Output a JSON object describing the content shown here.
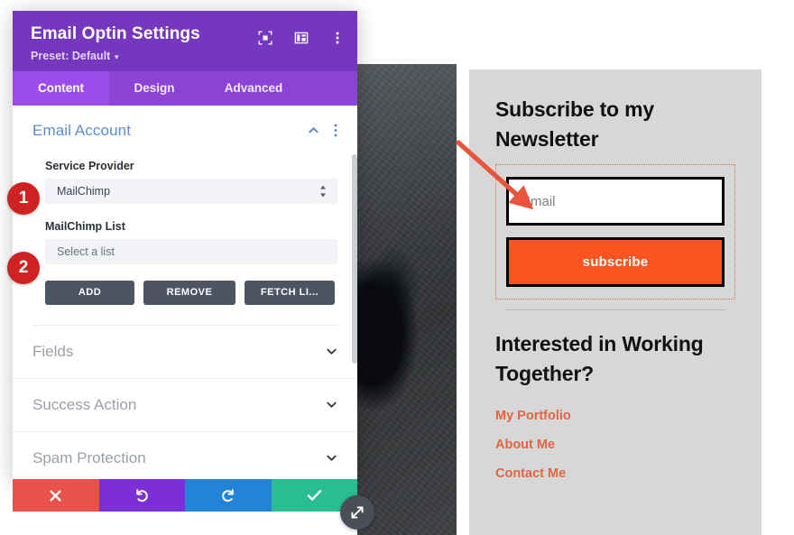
{
  "modal": {
    "title": "Email Optin Settings",
    "preset_label": "Preset: Default",
    "header_icons": [
      {
        "name": "focus-icon"
      },
      {
        "name": "layout-columns-icon"
      },
      {
        "name": "more-vertical-icon"
      }
    ],
    "tabs": [
      {
        "label": "Content",
        "active": true
      },
      {
        "label": "Design",
        "active": false
      },
      {
        "label": "Advanced",
        "active": false
      }
    ],
    "open_section": {
      "title": "Email Account",
      "fields": [
        {
          "label": "Service Provider",
          "value": "MailChimp",
          "muted": false
        },
        {
          "label": "MailChimp List",
          "value": "Select a list",
          "muted": true
        }
      ],
      "buttons": [
        {
          "label": "ADD"
        },
        {
          "label": "REMOVE"
        },
        {
          "label": "FETCH LI..."
        }
      ]
    },
    "closed_sections": [
      {
        "title": "Fields"
      },
      {
        "title": "Success Action"
      },
      {
        "title": "Spam Protection"
      }
    ],
    "action_buttons": [
      {
        "name": "cancel-button",
        "icon": "close-icon",
        "color": "#e8524a"
      },
      {
        "name": "undo-button",
        "icon": "undo-icon",
        "color": "#7b2fd4"
      },
      {
        "name": "redo-button",
        "icon": "redo-icon",
        "color": "#2184d6"
      },
      {
        "name": "save-button",
        "icon": "check-icon",
        "color": "#2bbd92"
      }
    ],
    "resize_handle": {
      "name": "resize-handle",
      "icon": "resize-diagonal-icon"
    }
  },
  "preview": {
    "newsletter_heading": "Subscribe to my Newsletter",
    "email_placeholder": "Email",
    "subscribe_label": "subscribe",
    "cta_heading": "Interested in Working Together?",
    "links": [
      {
        "label": "My Portfolio"
      },
      {
        "label": "About Me"
      },
      {
        "label": "Contact Me"
      }
    ]
  },
  "annotations": {
    "badges": [
      {
        "number": "1"
      },
      {
        "number": "2"
      }
    ],
    "arrow": {
      "name": "pointer-arrow",
      "color": "#e8543c"
    }
  },
  "colors": {
    "header_purple": "#7637bf",
    "tab_purple": "#8c44d7",
    "tab_active_purple": "#9b4ceb",
    "section_blue": "#5b8fc9",
    "button_gray": "#4c5564",
    "accent_orange": "#fa5420",
    "link_orange": "#e2653f",
    "badge_red": "#cf2222",
    "preview_bg": "#d7d7d7"
  }
}
